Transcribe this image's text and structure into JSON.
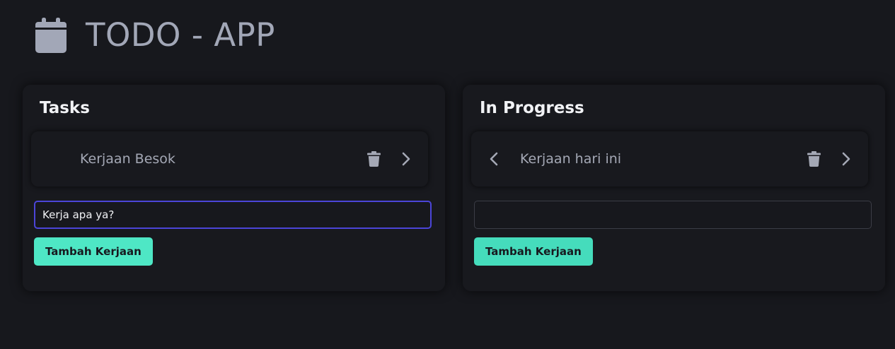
{
  "app": {
    "title": "TODO - APP",
    "icon": "calendar-icon",
    "colors": {
      "background": "#17181d",
      "title": "#a2a7b7",
      "accent": "#4ee7c5",
      "focus_border": "#4b45d8"
    }
  },
  "columns": [
    {
      "title": "Tasks",
      "tasks": [
        {
          "text": "Kerjaan Besok",
          "has_prev": false,
          "has_next": true
        }
      ],
      "input": {
        "value": "Kerja apa ya?",
        "placeholder": ""
      },
      "add_button_label": "Tambah Kerjaan"
    },
    {
      "title": "In Progress",
      "tasks": [
        {
          "text": "Kerjaan hari ini",
          "has_prev": true,
          "has_next": true
        }
      ],
      "input": {
        "value": "",
        "placeholder": ""
      },
      "add_button_label": "Tambah Kerjaan"
    }
  ]
}
